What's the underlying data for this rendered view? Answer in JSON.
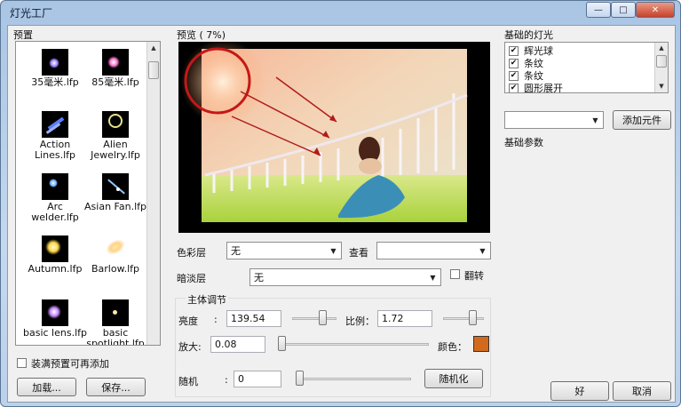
{
  "window": {
    "title": "灯光工厂",
    "minimize_glyph": "—",
    "maximize_glyph": "□",
    "close_glyph": "✕"
  },
  "presets": {
    "header": "预置",
    "items": [
      {
        "label": "35毫米.lfp",
        "icon": "lens-flare-thumb"
      },
      {
        "label": "85毫米.lfp",
        "icon": "lens-flare-thumb"
      },
      {
        "label": "Action Lines.lfp",
        "icon": "streaks-thumb"
      },
      {
        "label": "Alien Jewelry.lfp",
        "icon": "ring-flare-thumb"
      },
      {
        "label": "Arc welder.lfp",
        "icon": "spark-thumb"
      },
      {
        "label": "Asian Fan.lfp",
        "icon": "fan-streak-thumb"
      },
      {
        "label": "Autumn.lfp",
        "icon": "sun-glow-thumb"
      },
      {
        "label": "Barlow.lfp",
        "icon": "soft-glow-thumb"
      },
      {
        "label": "basic lens.lfp",
        "icon": "lens-flare-thumb"
      },
      {
        "label": "basic spotlight.lfp",
        "icon": "spotlight-thumb"
      }
    ],
    "add_checkbox_label": "装满预置可再添加",
    "load_button": "加载...",
    "save_button": "保存..."
  },
  "preview": {
    "header": "预览 (   7%)",
    "color_layer_label": "色彩层",
    "color_layer_value": "无",
    "view_label": "查看",
    "view_value": "",
    "dim_layer_label": "暗淡层",
    "dim_layer_value": "无",
    "flip_label": "翻转",
    "main_adjust_header": "主体调节",
    "brightness_label": "亮度",
    "brightness_value": "139.54",
    "ratio_label": "比例：",
    "ratio_value": "1.72",
    "scale_label": "放大:",
    "scale_value": "0.08",
    "color_label": "颜色：",
    "color_swatch": "#d26a1e",
    "random_label": "随机",
    "random_value": "0",
    "randomize_button": "随机化"
  },
  "lights": {
    "header": "基础的灯光",
    "items": [
      {
        "label": "辉光球",
        "checked": true
      },
      {
        "label": "条纹",
        "checked": true
      },
      {
        "label": "条纹",
        "checked": true
      },
      {
        "label": "圆形展开",
        "checked": true
      }
    ],
    "element_select_value": "",
    "add_element_button": "添加元件",
    "params_header": "基础参数"
  },
  "footer": {
    "ok_button": "好",
    "cancel_button": "取消"
  }
}
